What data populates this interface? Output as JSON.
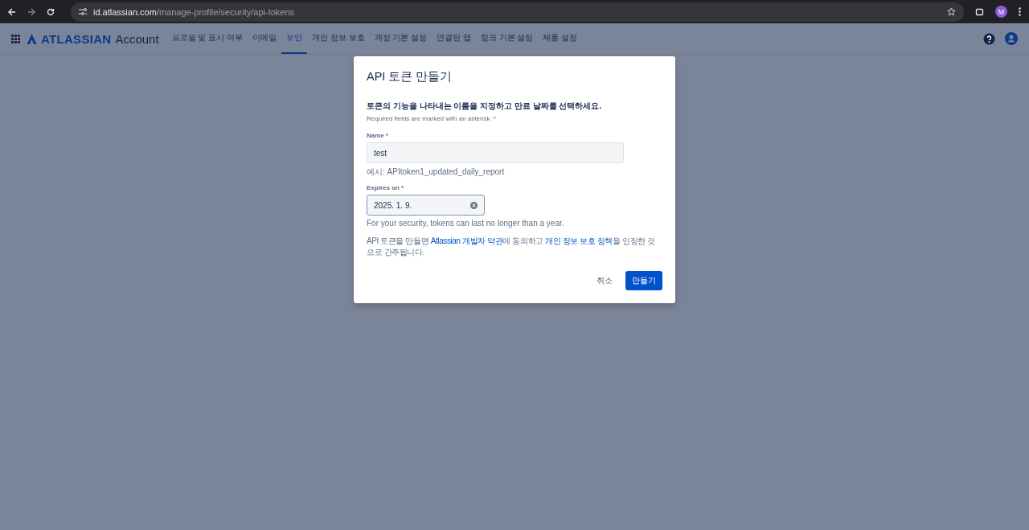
{
  "browser": {
    "url_host": "id.atlassian.com",
    "url_path": "/manage-profile/security/api-tokens",
    "profile_initial": "M"
  },
  "nav": {
    "logo_word": "ATLASSIAN",
    "logo_product": "Account",
    "tabs": [
      {
        "label": "프로필 및 표시 여부",
        "selected": false
      },
      {
        "label": "이메일",
        "selected": false
      },
      {
        "label": "보안",
        "selected": true
      },
      {
        "label": "개인 정보 보호",
        "selected": false
      },
      {
        "label": "계정 기본 설정",
        "selected": false
      },
      {
        "label": "연결된 앱",
        "selected": false
      },
      {
        "label": "링크 기본 설정",
        "selected": false
      },
      {
        "label": "제품 설정",
        "selected": false
      }
    ]
  },
  "dialog": {
    "title": "API 토큰 만들기",
    "subtitle": "토큰의 기능을 나타내는 이름을 지정하고 만료 날짜를 선택하세요.",
    "required_note": "Required fields are marked with an asterisk",
    "required_mark": "*",
    "fields": [
      {
        "kind": "text",
        "label": "Name",
        "required_mark": "*",
        "value": "test",
        "help": "예시: APItoken1_updated_daily_report"
      },
      {
        "kind": "date",
        "label": "Expires on",
        "required_mark": "*",
        "value": "2025. 1. 9.",
        "help": "For your security, tokens can last no longer than a year."
      }
    ],
    "consent": [
      {
        "kind": "text",
        "text": "API 토큰을 만들면 "
      },
      {
        "kind": "link",
        "text": "Atlassian 개발자 약관"
      },
      {
        "kind": "text",
        "text": "에 동의하고 "
      },
      {
        "kind": "link",
        "text": "개인 정보 보호 정책"
      },
      {
        "kind": "text",
        "text": "을 인정한 것으로 간주됩니다."
      }
    ],
    "cancel": "취소",
    "submit": "만들기"
  }
}
